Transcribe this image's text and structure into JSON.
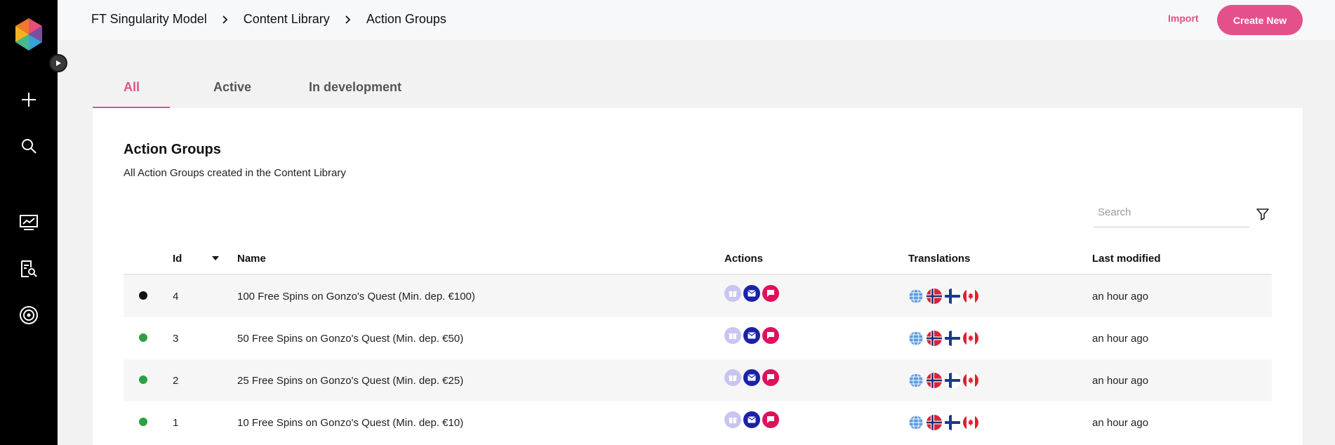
{
  "sidebar": {
    "icons": [
      "logo-icon",
      "collapse-arrow-icon",
      "plus-icon",
      "search-icon",
      "dashboard-chart-icon",
      "report-search-icon",
      "target-icon"
    ]
  },
  "header": {
    "breadcrumb": [
      "FT Singularity Model",
      "Content Library",
      "Action Groups"
    ],
    "import_label": "Import",
    "create_label": "Create New"
  },
  "tabs": [
    {
      "label": "All",
      "active": true
    },
    {
      "label": "Active",
      "active": false
    },
    {
      "label": "In development",
      "active": false
    }
  ],
  "card": {
    "title": "Action Groups",
    "subtitle": "All Action Groups created in the Content Library"
  },
  "search": {
    "placeholder": "Search"
  },
  "table": {
    "columns": [
      "Id",
      "Name",
      "Actions",
      "Translations",
      "Last modified"
    ],
    "rows": [
      {
        "status": "inactive",
        "id": "4",
        "name": "100 Free Spins on Gonzo's Quest (Min. dep. €100)",
        "modified": "an hour ago"
      },
      {
        "status": "active",
        "id": "3",
        "name": "50 Free Spins on Gonzo's Quest (Min. dep. €50)",
        "modified": "an hour ago"
      },
      {
        "status": "active",
        "id": "2",
        "name": "25 Free Spins on Gonzo's Quest (Min. dep. €25)",
        "modified": "an hour ago"
      },
      {
        "status": "active",
        "id": "1",
        "name": "10 Free Spins on Gonzo's Quest (Min. dep. €10)",
        "modified": "an hour ago"
      }
    ]
  },
  "colors": {
    "accent": "#e4508a",
    "status_active": "#2ea043",
    "status_inactive": "#111111",
    "action_gift": "#c9c5f1",
    "action_mail": "#1a22a8",
    "action_message": "#e0105e"
  },
  "actions_icons": [
    "gift-icon",
    "mail-icon",
    "message-icon"
  ],
  "translation_flags": [
    "globe-flag",
    "norway-flag",
    "finland-flag",
    "canada-flag"
  ]
}
